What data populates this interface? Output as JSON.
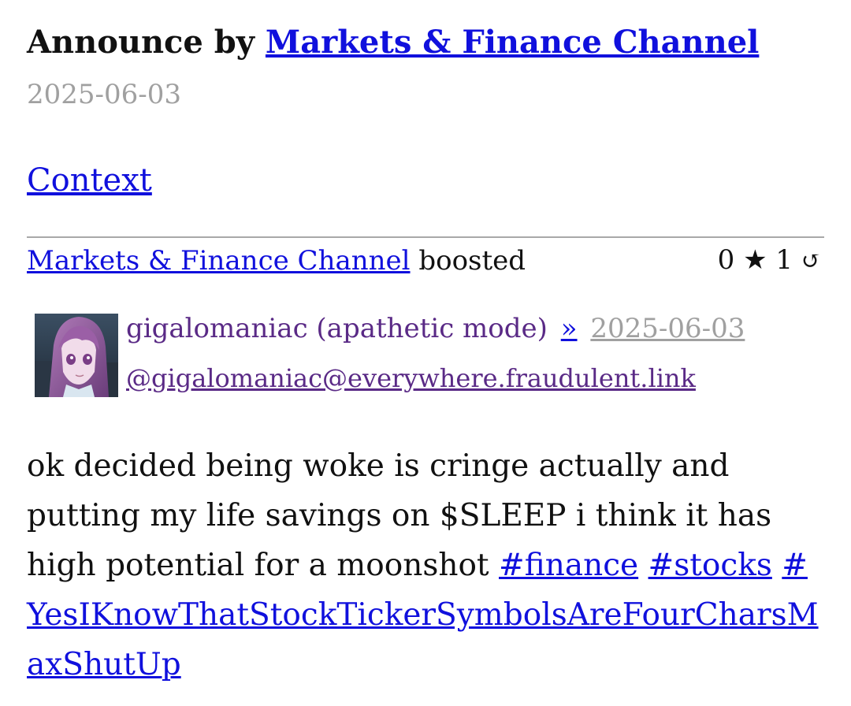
{
  "announce": {
    "prefix": "Announce by",
    "channel": "Markets & Finance Channel",
    "date": "2025-06-03"
  },
  "context_label": "Context",
  "boost": {
    "channel": "Markets & Finance Channel",
    "action": "boosted",
    "favorites": "0",
    "star_icon": "★",
    "boosts": "1",
    "refresh_icon": "↺"
  },
  "post": {
    "display_name": "gigalomaniac (apathetic mode)",
    "raquo": "»",
    "date": "2025-06-03",
    "handle": "@gigalomaniac@everywhere.fraudulent.link",
    "avatar_icon": "anime-girl-avatar",
    "text": "ok decided being woke is cringe actually and putting my life savings on $SLEEP i think it has high potential for a moonshot",
    "tags": [
      "#finance",
      "#stocks",
      "#YesIKnowThatStockTickerSymbolsAreFourCharsMaxShutUp"
    ]
  },
  "colors": {
    "link": "#1010dd",
    "visited": "#5a2a86",
    "muted": "#a0a0a0"
  }
}
